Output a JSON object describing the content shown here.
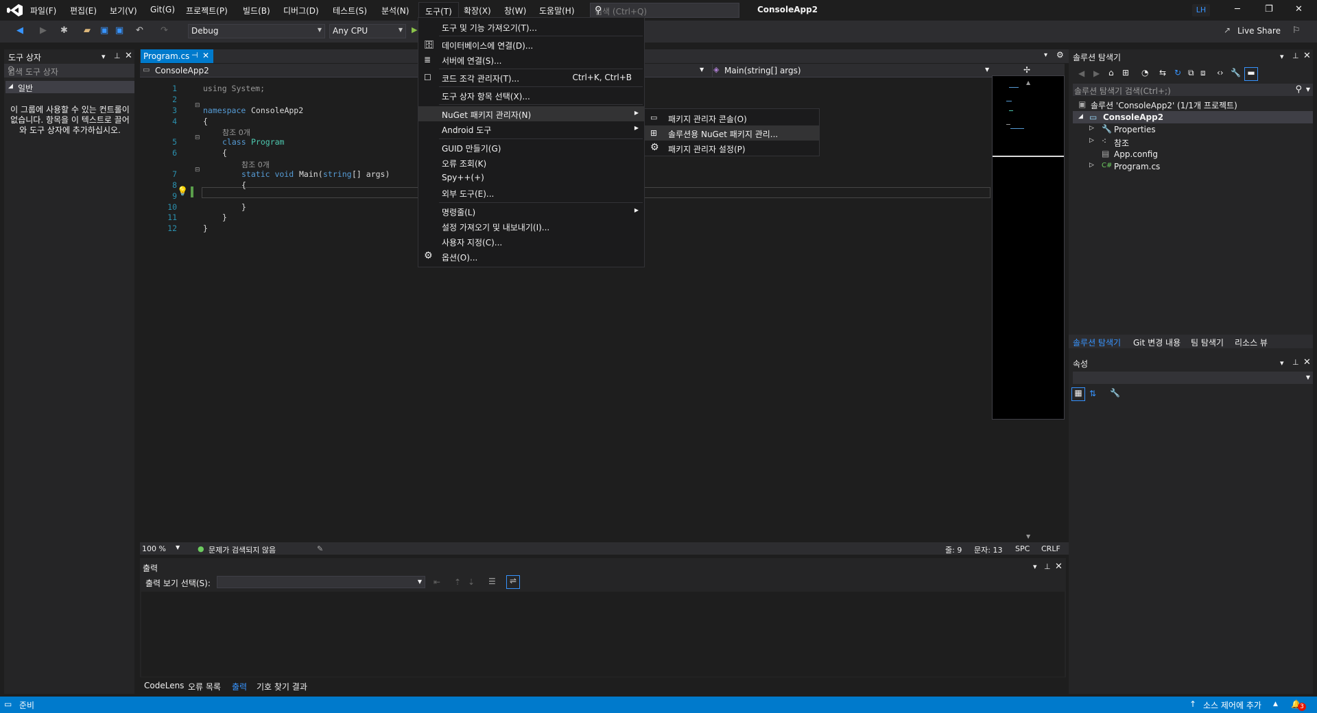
{
  "menu": {
    "items": [
      "파일(F)",
      "편집(E)",
      "보기(V)",
      "Git(G)",
      "프로젝트(P)",
      "빌드(B)",
      "디버그(D)",
      "테스트(S)",
      "분석(N)",
      "도구(T)",
      "확장(X)",
      "창(W)",
      "도움말(H)"
    ],
    "search_placeholder": "검색 (Ctrl+Q)",
    "app_title": "ConsoleApp2",
    "user_initials": "LH"
  },
  "toolbar": {
    "configuration": "Debug",
    "platform": "Any CPU",
    "live_share": "Live Share"
  },
  "toolbox": {
    "title": "도구 상자",
    "search_placeholder": "검색 도구 상자",
    "group": "일반",
    "empty_message": "이 그룹에 사용할 수 있는 컨트롤이 없습니다. 항목을 이 텍스트로 끌어와 도구 상자에 추가하십시오."
  },
  "editor": {
    "tab_label": "Program.cs",
    "nav_project": "ConsoleApp2",
    "nav_member": "Main(string[] args)",
    "lines": [
      {
        "n": "1",
        "indent": 0,
        "parts": [
          {
            "t": "using System;",
            "c": "ref"
          }
        ]
      },
      {
        "n": "2",
        "indent": 0,
        "parts": []
      },
      {
        "n": "3",
        "indent": 0,
        "parts": [
          {
            "t": "namespace ",
            "c": "kw"
          },
          {
            "t": "ConsoleApp2",
            "c": "plain"
          }
        ]
      },
      {
        "n": "4",
        "indent": 0,
        "parts": [
          {
            "t": "{",
            "c": "plain"
          }
        ]
      },
      {
        "n": "",
        "indent": 1,
        "parts": [
          {
            "t": "참조 0개",
            "c": "ref"
          }
        ]
      },
      {
        "n": "5",
        "indent": 1,
        "parts": [
          {
            "t": "class ",
            "c": "kw"
          },
          {
            "t": "Program",
            "c": "type"
          }
        ]
      },
      {
        "n": "6",
        "indent": 1,
        "parts": [
          {
            "t": "{",
            "c": "plain"
          }
        ]
      },
      {
        "n": "",
        "indent": 2,
        "parts": [
          {
            "t": "참조 0개",
            "c": "ref"
          }
        ]
      },
      {
        "n": "7",
        "indent": 2,
        "parts": [
          {
            "t": "static void ",
            "c": "kw"
          },
          {
            "t": "Main(",
            "c": "plain"
          },
          {
            "t": "string",
            "c": "kw"
          },
          {
            "t": "[] args)",
            "c": "plain"
          }
        ]
      },
      {
        "n": "8",
        "indent": 2,
        "parts": [
          {
            "t": "{",
            "c": "plain"
          }
        ]
      },
      {
        "n": "9",
        "indent": 0,
        "parts": []
      },
      {
        "n": "10",
        "indent": 2,
        "parts": [
          {
            "t": "}",
            "c": "plain"
          }
        ]
      },
      {
        "n": "11",
        "indent": 1,
        "parts": [
          {
            "t": "}",
            "c": "plain"
          }
        ]
      },
      {
        "n": "12",
        "indent": 0,
        "parts": [
          {
            "t": "}",
            "c": "plain"
          }
        ]
      }
    ],
    "zoom": "100 %",
    "issues": "문제가 검색되지 않음",
    "line": "줄: 9",
    "char": "문자: 13",
    "spc": "SPC",
    "crlf": "CRLF"
  },
  "output": {
    "title": "출력",
    "source_label": "출력 보기 선택(S):",
    "tabs": [
      "CodeLens",
      "오류 목록",
      "출력",
      "기호 찾기 결과"
    ]
  },
  "solution_explorer": {
    "title": "솔루션 탐색기",
    "search_placeholder": "솔루션 탐색기 검색(Ctrl+;)",
    "solution": "솔루션 'ConsoleApp2' (1/1개 프로젝트)",
    "project": "ConsoleApp2",
    "nodes": [
      "Properties",
      "참조",
      "App.config",
      "Program.cs"
    ],
    "tabs": [
      "솔루션 탐색기",
      "Git 변경 내용",
      "팀 탐색기",
      "리소스 뷰"
    ]
  },
  "properties": {
    "title": "속성"
  },
  "tools_menu": {
    "items": [
      {
        "label": "도구 및 기능 가져오기(T)...",
        "shortcut": "",
        "submenu": false,
        "icon": ""
      },
      {
        "label": "데이터베이스에 연결(D)...",
        "shortcut": "",
        "submenu": false,
        "icon": "db-icon"
      },
      {
        "label": "서버에 연결(S)...",
        "shortcut": "",
        "submenu": false,
        "icon": "server-icon"
      },
      {
        "label": "코드 조각 관리자(T)...",
        "shortcut": "Ctrl+K, Ctrl+B",
        "submenu": false,
        "icon": "checkbox-icon"
      },
      {
        "label": "도구 상자 항목 선택(X)...",
        "shortcut": "",
        "submenu": false,
        "icon": ""
      },
      {
        "label": "NuGet 패키지 관리자(N)",
        "shortcut": "",
        "submenu": true,
        "icon": ""
      },
      {
        "label": "Android 도구",
        "shortcut": "",
        "submenu": true,
        "icon": ""
      },
      {
        "label": "GUID 만들기(G)",
        "shortcut": "",
        "submenu": false,
        "icon": ""
      },
      {
        "label": "오류 조회(K)",
        "shortcut": "",
        "submenu": false,
        "icon": ""
      },
      {
        "label": "Spy++(+)",
        "shortcut": "",
        "submenu": false,
        "icon": ""
      },
      {
        "label": "외부 도구(E)...",
        "shortcut": "",
        "submenu": false,
        "icon": ""
      },
      {
        "label": "명령줄(L)",
        "shortcut": "",
        "submenu": true,
        "icon": ""
      },
      {
        "label": "설정 가져오기 및 내보내기(I)...",
        "shortcut": "",
        "submenu": false,
        "icon": ""
      },
      {
        "label": "사용자 지정(C)...",
        "shortcut": "",
        "submenu": false,
        "icon": ""
      },
      {
        "label": "옵션(O)...",
        "shortcut": "",
        "submenu": false,
        "icon": "gear-icon"
      }
    ]
  },
  "nuget_submenu": {
    "items": [
      {
        "label": "패키지 관리자 콘솔(O)",
        "icon": "console-icon"
      },
      {
        "label": "솔루션용 NuGet 패키지 관리...",
        "icon": "package-icon"
      },
      {
        "label": "패키지 관리자 설정(P)",
        "icon": "gear-icon"
      }
    ]
  },
  "statusbar": {
    "ready": "준비",
    "source_control": "소스 제어에 추가",
    "notifications": "3"
  }
}
